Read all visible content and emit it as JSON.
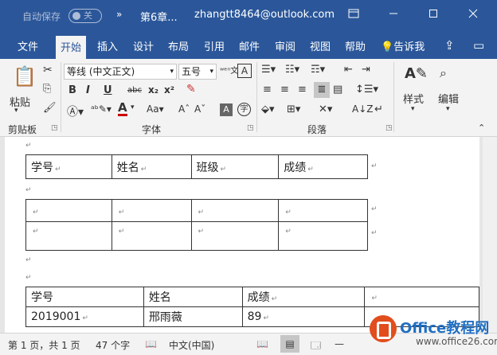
{
  "titlebar": {
    "autosave_label": "自动保存",
    "autosave_state": "关",
    "more_label": "»",
    "doc_name": "第6章...",
    "account": "zhangtt8464@outlook.com",
    "ribbon_display_icon": "ribbon-display-icon",
    "minimize_icon": "minimize-icon",
    "restore_icon": "restore-icon",
    "close_icon": "close-icon"
  },
  "tabs": [
    "文件",
    "开始",
    "插入",
    "设计",
    "布局",
    "引用",
    "邮件",
    "审阅",
    "视图",
    "帮助"
  ],
  "active_tab": "开始",
  "tell_me": "告诉我",
  "ribbon": {
    "clipboard": {
      "paste": "粘贴",
      "label": "剪贴板"
    },
    "font": {
      "name": "等线 (中文正文)",
      "size": "五号",
      "label": "字体"
    },
    "paragraph": {
      "label": "段落"
    },
    "styles": {
      "label": "样式"
    },
    "editing": {
      "label": "编辑"
    }
  },
  "table1": [
    [
      "学号",
      "姓名",
      "班级",
      "成绩"
    ]
  ],
  "table2": [
    [
      "",
      "",
      "",
      ""
    ],
    [
      "",
      "",
      "",
      ""
    ]
  ],
  "table3": [
    [
      "学号",
      "姓名",
      "成绩",
      ""
    ],
    [
      "2019001",
      "邢雨薇",
      "89",
      ""
    ]
  ],
  "paragraph_mark": "↵",
  "cell_mark": "↵",
  "status": {
    "page": "第 1 页，共 1 页",
    "words": "47 个字",
    "language": "中文(中国)",
    "zoom": "—"
  },
  "watermark": {
    "brand": "Office教程网",
    "url": "www.office26.com"
  }
}
